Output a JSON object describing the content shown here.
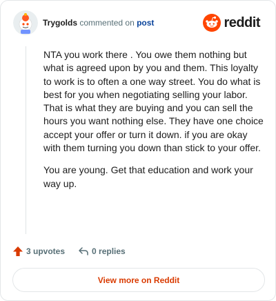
{
  "header": {
    "username": "Trygolds",
    "action_text": "commented on",
    "post_link": "post",
    "brand": "reddit"
  },
  "comment": {
    "paragraphs": [
      "NTA you work there . You owe them nothing but what is agreed upon by you and them. This loyalty to work is to often a one way street. You do what is best for you when negotiating selling your labor. That is what they are buying and you can sell the hours you want nothing else. They have one choice accept your offer or turn it down. if you are okay with them turning you down than stick to your offer.",
      "You are young. Get that education and work your way up."
    ]
  },
  "actions": {
    "upvotes": "3 upvotes",
    "replies": "0 replies"
  },
  "footer": {
    "view_more": "View more on Reddit"
  },
  "colors": {
    "brand_orange": "#ff4500",
    "upvote_orange": "#d93a00",
    "link_blue": "#0a449b",
    "muted_gray": "#576f76"
  },
  "icons": {
    "avatar": "snoo-avatar-icon",
    "brand": "reddit-logo-icon",
    "upvote": "upvote-arrow-icon",
    "reply": "reply-arrow-icon"
  }
}
